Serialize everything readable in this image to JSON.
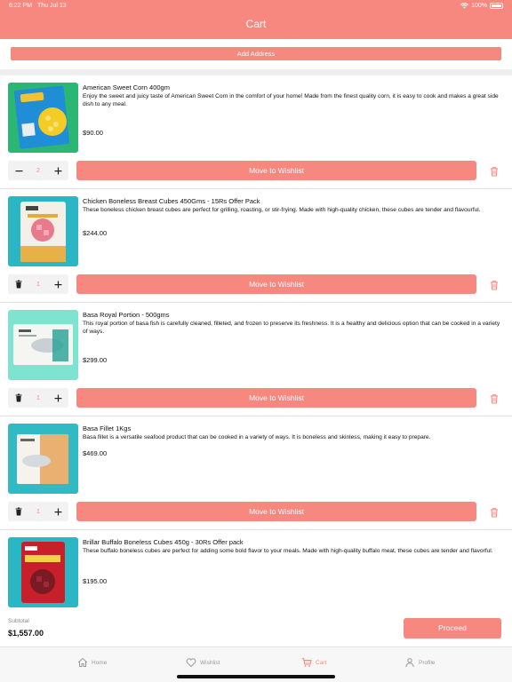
{
  "status_bar": {
    "time": "6:22 PM",
    "date": "Thu Jul 13",
    "battery": "100%"
  },
  "header": {
    "title": "Cart"
  },
  "address_button": "Add Address",
  "items": [
    {
      "name": "American Sweet Corn 400gm",
      "description": "Enjoy the sweet and juicy taste of American Sweet Corn in the comfort of your home! Made from the finest quality corn, it is easy to cook and makes a great side dish to any meal.",
      "price": "$90.00",
      "quantity": "2",
      "decrement_icon": "minus-icon",
      "wishlist_label": "Move to Wishlist"
    },
    {
      "name": "Chicken Boneless Breast Cubes 450Gms - 15Rs Offer Pack",
      "description": "These boneless chicken breast cubes are perfect for grilling, roasting, or stir-frying. Made with high-quality chicken, these cubes are tender and flavourful.",
      "price": "$244.00",
      "quantity": "1",
      "decrement_icon": "trash-icon",
      "wishlist_label": "Move to Wishlist"
    },
    {
      "name": "Basa Royal Portion - 500gms",
      "description": "This royal portion of basa fish is carefully cleaned, filleted, and frozen to preserve its freshness. It is a healthy and delicious option that can be cooked in a variety of ways.",
      "price": "$299.00",
      "quantity": "1",
      "decrement_icon": "trash-icon",
      "wishlist_label": "Move to Wishlist"
    },
    {
      "name": "Basa Fillet 1Kgs",
      "description": "Basa fillet is a versatile seafood product that can be cooked in a variety of ways. It is boneless and skinless, making it easy to prepare.",
      "price": "$469.00",
      "quantity": "1",
      "decrement_icon": "trash-icon",
      "wishlist_label": "Move to Wishlist"
    },
    {
      "name": "Brillar Buffalo Boneless Cubes 450g - 30Rs Offer pack",
      "description": "These buffalo boneless cubes are perfect for adding some bold flavor to your meals. Made with high-quality buffalo meat, these cubes are tender and flavorful.",
      "price": "$195.00"
    }
  ],
  "footer": {
    "subtotal_label": "Subtotal",
    "subtotal_value": "$1,557.00",
    "proceed_label": "Proceed"
  },
  "tabs": [
    {
      "label": "Home",
      "icon": "home-icon"
    },
    {
      "label": "Wishlist",
      "icon": "heart-icon"
    },
    {
      "label": "Cart",
      "icon": "cart-icon",
      "active": true
    },
    {
      "label": "Profile",
      "icon": "person-icon"
    }
  ],
  "colors": {
    "accent": "#f68880",
    "background": "#ffffff",
    "divider": "#efefef"
  }
}
